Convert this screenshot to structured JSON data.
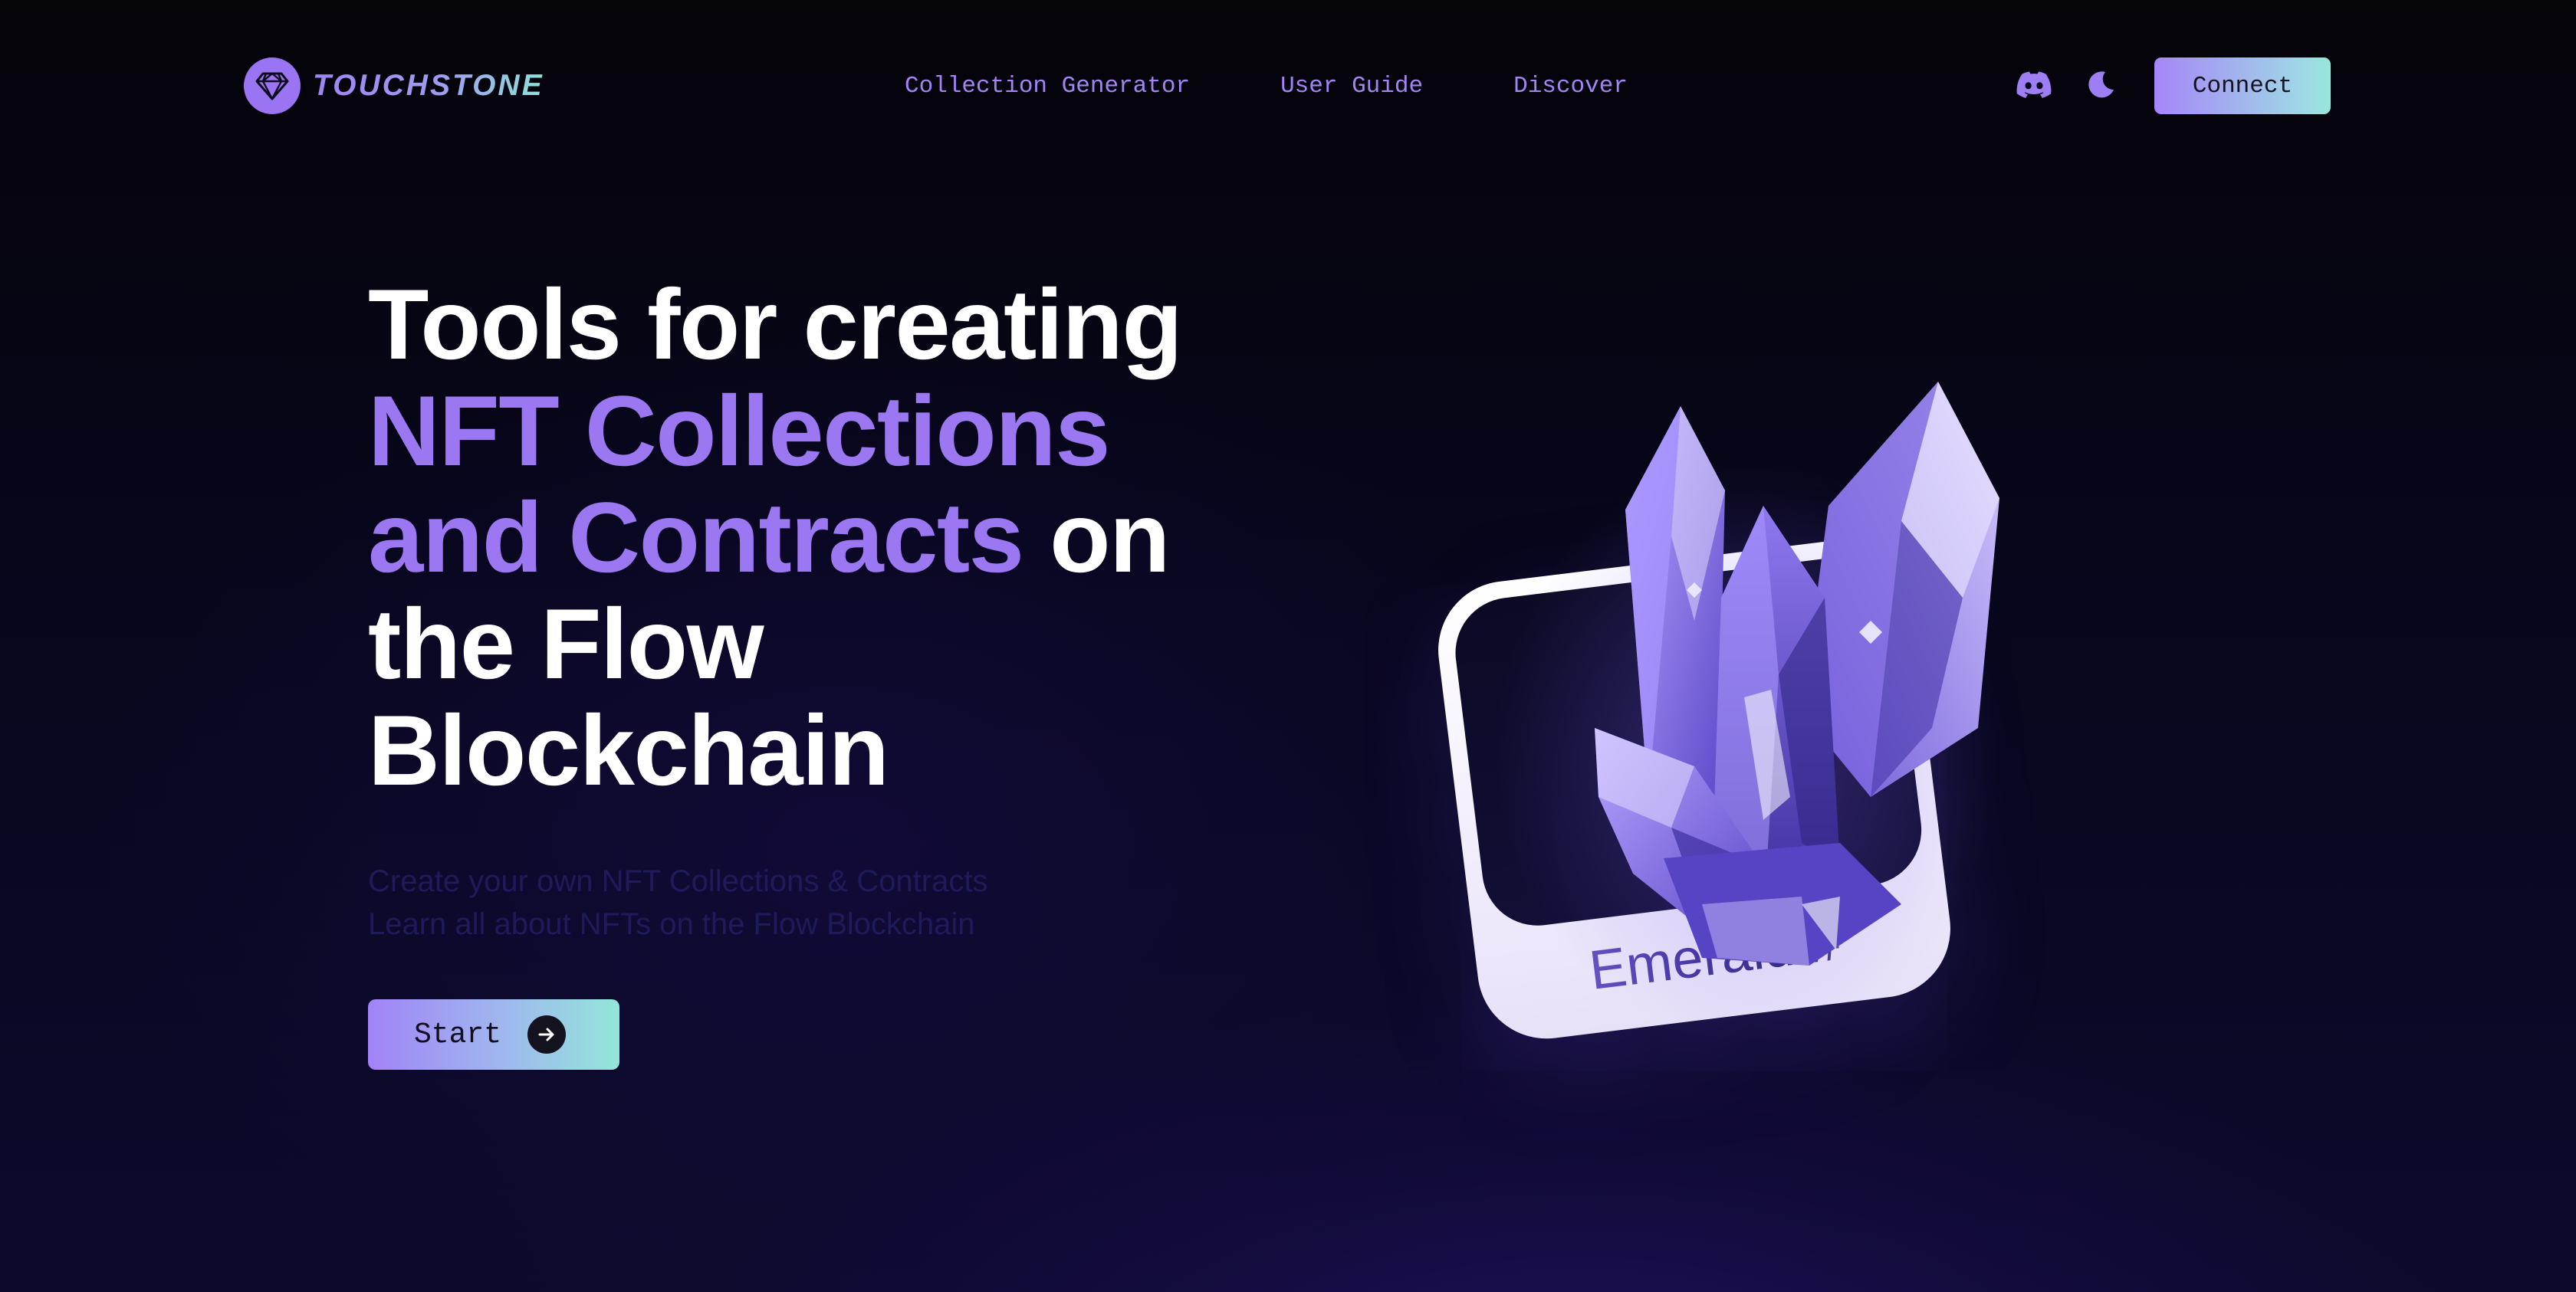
{
  "brand": {
    "name": "TOUCHSTONE",
    "logo_icon": "diamond-icon",
    "accent_color": "#9b78f2",
    "gradient_end_color": "#93e6da"
  },
  "nav": {
    "links": [
      {
        "label": "Collection Generator"
      },
      {
        "label": "User Guide"
      },
      {
        "label": "Discover"
      }
    ],
    "icons": [
      "discord-icon",
      "moon-icon"
    ],
    "connect_label": "Connect"
  },
  "hero": {
    "title_line1": "Tools for creating",
    "title_accent_line2": "NFT Collections",
    "title_accent_line3": "and Contracts",
    "title_line3_suffix": " on",
    "title_line4": "the Flow",
    "title_line5": "Blockchain",
    "subtitle_line1": "Create your own NFT Collections & Contracts",
    "subtitle_line2": "Learn all about NFTs on the Flow Blockchain",
    "start_label": "Start",
    "start_icon": "arrow-right-icon"
  },
  "illustration": {
    "card_label": "Emerald #"
  }
}
